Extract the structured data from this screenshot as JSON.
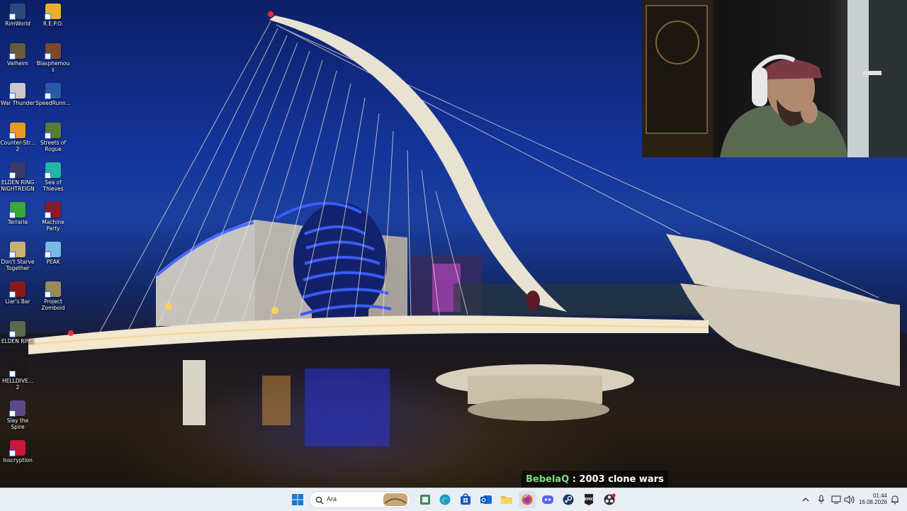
{
  "desktop": {
    "icons": [
      {
        "label": "RimWorld",
        "icon": "rimworld-icon",
        "color": "#2a4a7c"
      },
      {
        "label": "R.E.P.O.",
        "icon": "repo-icon",
        "color": "#e8b02c"
      },
      {
        "label": "Valheim",
        "icon": "valheim-icon",
        "color": "#6b5a3a"
      },
      {
        "label": "Blasphemous",
        "icon": "blasphemous-icon",
        "color": "#7a4a2a"
      },
      {
        "label": "War Thunder",
        "icon": "war-thunder-icon",
        "color": "#c8c8c8"
      },
      {
        "label": "SpeedRunn...",
        "icon": "speedrunners-icon",
        "color": "#2a5aa8"
      },
      {
        "label": "Counter-Str... 2",
        "icon": "counter-strike-icon",
        "color": "#e89a20"
      },
      {
        "label": "Streets of Rogue",
        "icon": "streets-of-rogue-icon",
        "color": "#5a7a3a"
      },
      {
        "label": "ELDEN RING NIGHTREIGN",
        "icon": "elden-ring-nightreign-icon",
        "color": "#3a3a6a"
      },
      {
        "label": "Sea of Thieves",
        "icon": "sea-of-thieves-icon",
        "color": "#1fb8a8"
      },
      {
        "label": "Terraria",
        "icon": "terraria-icon",
        "color": "#3aa83a"
      },
      {
        "label": "Machine Party",
        "icon": "machine-party-icon",
        "color": "#8a1a2a"
      },
      {
        "label": "Don't Starve Together",
        "icon": "dont-starve-together-icon",
        "color": "#c8b070"
      },
      {
        "label": "PEAK",
        "icon": "peak-icon",
        "color": "#7ab8e8"
      },
      {
        "label": "Liar's Bar",
        "icon": "liars-bar-icon",
        "color": "#8a1a1a"
      },
      {
        "label": "Project Zomboid",
        "icon": "project-zomboid-icon",
        "color": "#9a8a5a"
      },
      {
        "label": "ELDEN RING",
        "icon": "elden-ring-icon",
        "color": "#5a6a4a"
      },
      {
        "label": "HELLDIVE... 2",
        "icon": "helldivers-icon",
        "color": "#1a1a1a"
      },
      {
        "label": "Slay the Spire",
        "icon": "slay-the-spire-icon",
        "color": "#5a4a8a"
      },
      {
        "label": "Inscryption",
        "icon": "inscryption-icon",
        "color": "#c81a3a"
      }
    ]
  },
  "chat": {
    "user": "BebelaQ",
    "separator": " : ",
    "message": "2003 clone wars"
  },
  "taskbar": {
    "search_placeholder": "Ara",
    "apps": [
      {
        "icon": "start-icon",
        "color": "#1a78d8"
      },
      {
        "icon": "edge-icon",
        "color": "#1a9ad8"
      },
      {
        "icon": "store-icon",
        "color": "#1a5ab8"
      },
      {
        "icon": "outlook-icon",
        "color": "#1a6ad8"
      },
      {
        "icon": "file-explorer-icon",
        "color": "#f0c040"
      },
      {
        "icon": "firefox-icon",
        "color": "#e8602a"
      },
      {
        "icon": "discord-icon",
        "color": "#5865f2"
      },
      {
        "icon": "steam-icon",
        "color": "#1a3a6a"
      },
      {
        "icon": "epic-games-icon",
        "color": "#222222"
      },
      {
        "icon": "obs-icon",
        "color": "#333333"
      }
    ],
    "clock": {
      "time": "01:44",
      "date": "16.08.2026"
    }
  }
}
